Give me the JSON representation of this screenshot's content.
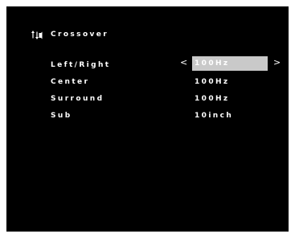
{
  "screen": {
    "title": "Crossover",
    "icon": "speaker-settings-icon"
  },
  "rows": [
    {
      "label": "Left/Right",
      "value": "100Hz",
      "selected": true
    },
    {
      "label": "Center",
      "value": "100Hz",
      "selected": false
    },
    {
      "label": "Surround",
      "value": "100Hz",
      "selected": false
    },
    {
      "label": "Sub",
      "value": "10inch",
      "selected": false
    }
  ],
  "arrows": {
    "left": "<",
    "right": ">"
  },
  "colors": {
    "background": "#000000",
    "text": "#ffffff",
    "highlight": "#c9c9c9"
  }
}
